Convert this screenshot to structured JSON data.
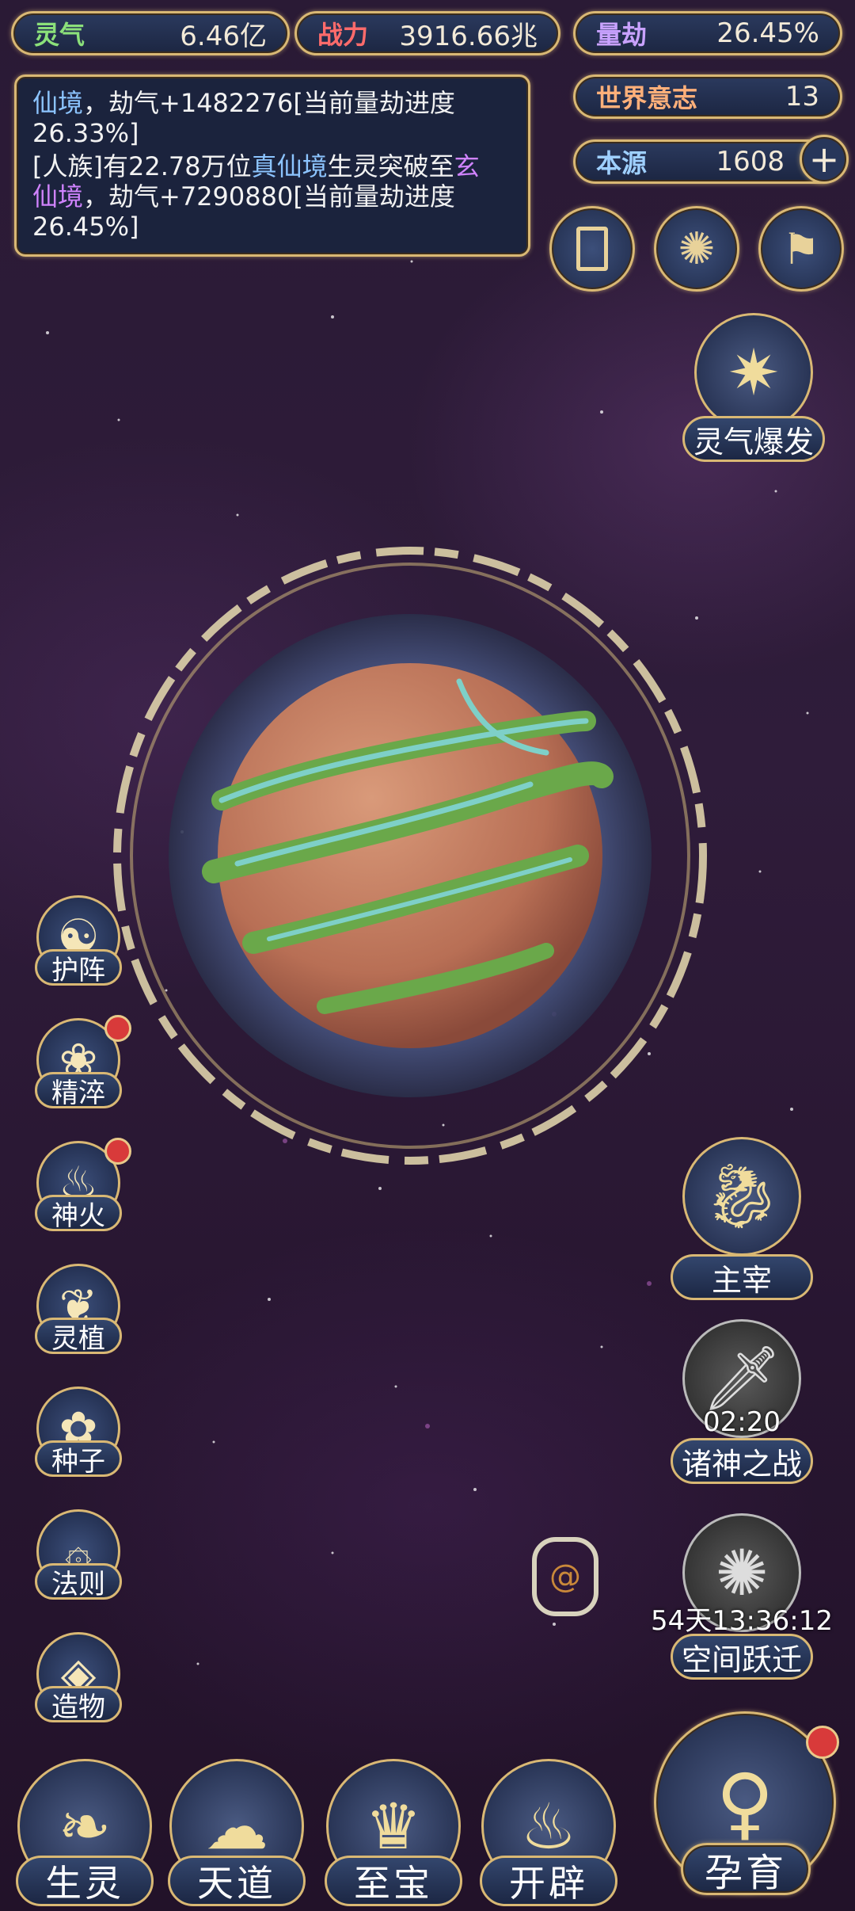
{
  "top_bar": {
    "lingqi": {
      "label": "灵气",
      "value": "6.46亿"
    },
    "zhanli": {
      "label": "战力",
      "value": "3916.66兆"
    },
    "liangjie": {
      "label": "量劫",
      "value": "26.45%"
    },
    "shijie_yizhi": {
      "label": "世界意志",
      "value": "13"
    },
    "benyuan": {
      "label": "本源",
      "value": "1608"
    }
  },
  "log": {
    "line1_realm": "仙境",
    "line1_rest": "，劫气+1482276[当前量劫进度",
    "line1_pct": "26.33%]",
    "line2_pre": "[人族]有22.78万位",
    "line2_realm1": "真仙境",
    "line2_mid": "生灵突破至",
    "line2_realm2_a": "玄",
    "line2_realm2_b": "仙境",
    "line2_rest": "，劫气+7290880[当前量劫进度",
    "line2_pct": "26.45%]"
  },
  "right_panel": {
    "burst": "灵气爆发",
    "zhuzai": "主宰",
    "zhushen": {
      "label": "诸神之战",
      "timer": "02:20"
    },
    "kongjian": {
      "label": "空间跃迁",
      "timer": "54天13:36:12"
    }
  },
  "left_menu": [
    "护阵",
    "精淬",
    "神火",
    "灵植",
    "种子",
    "法则",
    "造物"
  ],
  "bottom_menu": [
    "生灵",
    "天道",
    "至宝",
    "开辟",
    "孕育"
  ],
  "colors": {
    "gold": "#d9b874",
    "badge_red": "#d83a3a",
    "panel": "#1c2642",
    "highlight_blue": "#8cc4ff",
    "highlight_purple": "#d083ff"
  }
}
